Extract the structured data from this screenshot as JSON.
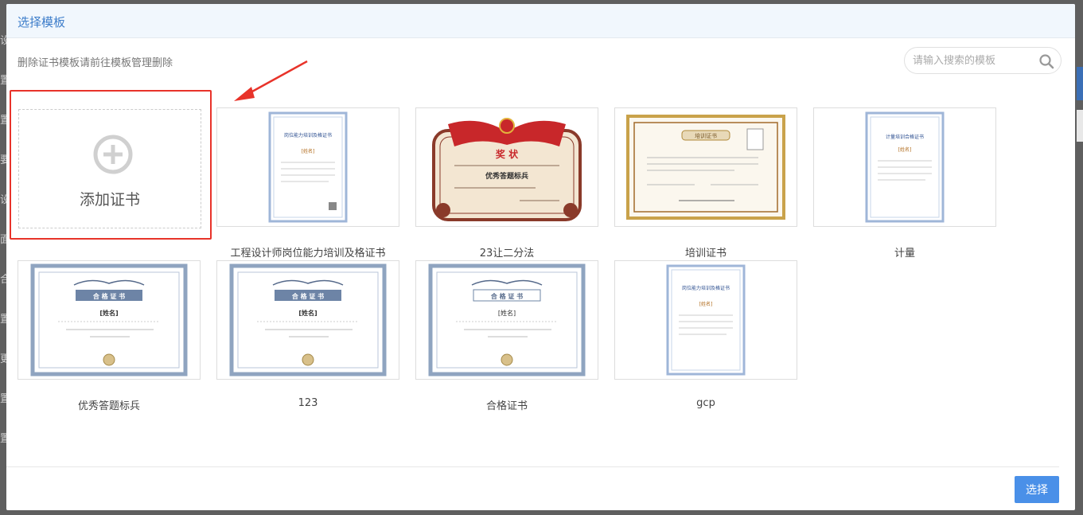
{
  "modal": {
    "title": "选择模板",
    "hint": "删除证书模板请前往模板管理删除",
    "search": {
      "placeholder": "请输入搜索的模板",
      "value": ""
    },
    "add_card": {
      "label": "添加证书"
    },
    "templates": [
      {
        "name": "工程设计师岗位能力培训及格证书"
      },
      {
        "name": "23让二分法"
      },
      {
        "name": "培训证书"
      },
      {
        "name": "计量"
      },
      {
        "name": "优秀答题标兵"
      },
      {
        "name": "123"
      },
      {
        "name": "合格证书"
      },
      {
        "name": "gcp"
      }
    ],
    "footer": {
      "select_label": "选择"
    }
  },
  "thumb_text": {
    "job_title": "岗位能力培训及格证书",
    "name_field": "[姓名]",
    "award": "奖 状",
    "award_sub": "优秀答题标兵",
    "training": "培训证书",
    "metrology": "计量培训合格证书",
    "pass": "合 格 证 书"
  },
  "colors": {
    "accent": "#3d7dca",
    "button": "#4a90e8",
    "highlight": "#e8332a"
  }
}
